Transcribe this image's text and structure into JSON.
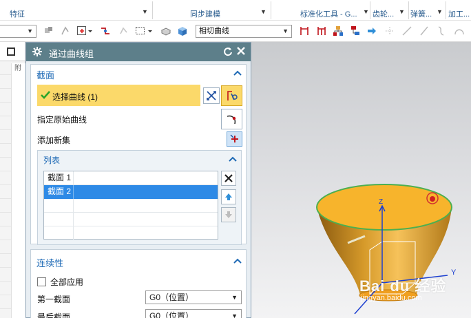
{
  "ribbon": {
    "groups": [
      {
        "label": "特征"
      },
      {
        "label": "同步建模"
      },
      {
        "label": "标准化工具 - G..."
      },
      {
        "label": "齿轮..."
      },
      {
        "label": "弹簧..."
      },
      {
        "label": "加工..."
      }
    ]
  },
  "toolbar": {
    "filter_combo": "",
    "curve_rule": "相切曲线"
  },
  "dialog": {
    "title": "通过曲线组",
    "section": {
      "header": "截面",
      "select_curve_label": "选择曲线 (1)",
      "origin_curve_label": "指定原始曲线",
      "add_set_label": "添加新集",
      "list_header": "列表",
      "list_items": [
        {
          "label": "截面 1",
          "selected": false
        },
        {
          "label": "截面 2",
          "selected": true
        }
      ]
    },
    "continuity": {
      "header": "连续性",
      "apply_all_label": "全部应用",
      "apply_all_checked": false,
      "first_section_label": "第一截面",
      "first_section_value": "G0（位置）",
      "last_section_label": "最后截面",
      "last_section_value": "G0（位置）"
    }
  },
  "leftstrip": {
    "col_caption": "附"
  },
  "viewport": {
    "axis_z": "Z",
    "axis_y": "Y",
    "watermark": "Bai du 经验",
    "watermark_url": "jingyan.baidu.com",
    "surface_color": "#f7b42c",
    "edge_color": "#4caf50"
  },
  "colors": {
    "accent": "#1d69b5",
    "title_bar": "#5d7f8a",
    "highlight": "#fbd96a",
    "selection": "#2e8ae6"
  }
}
